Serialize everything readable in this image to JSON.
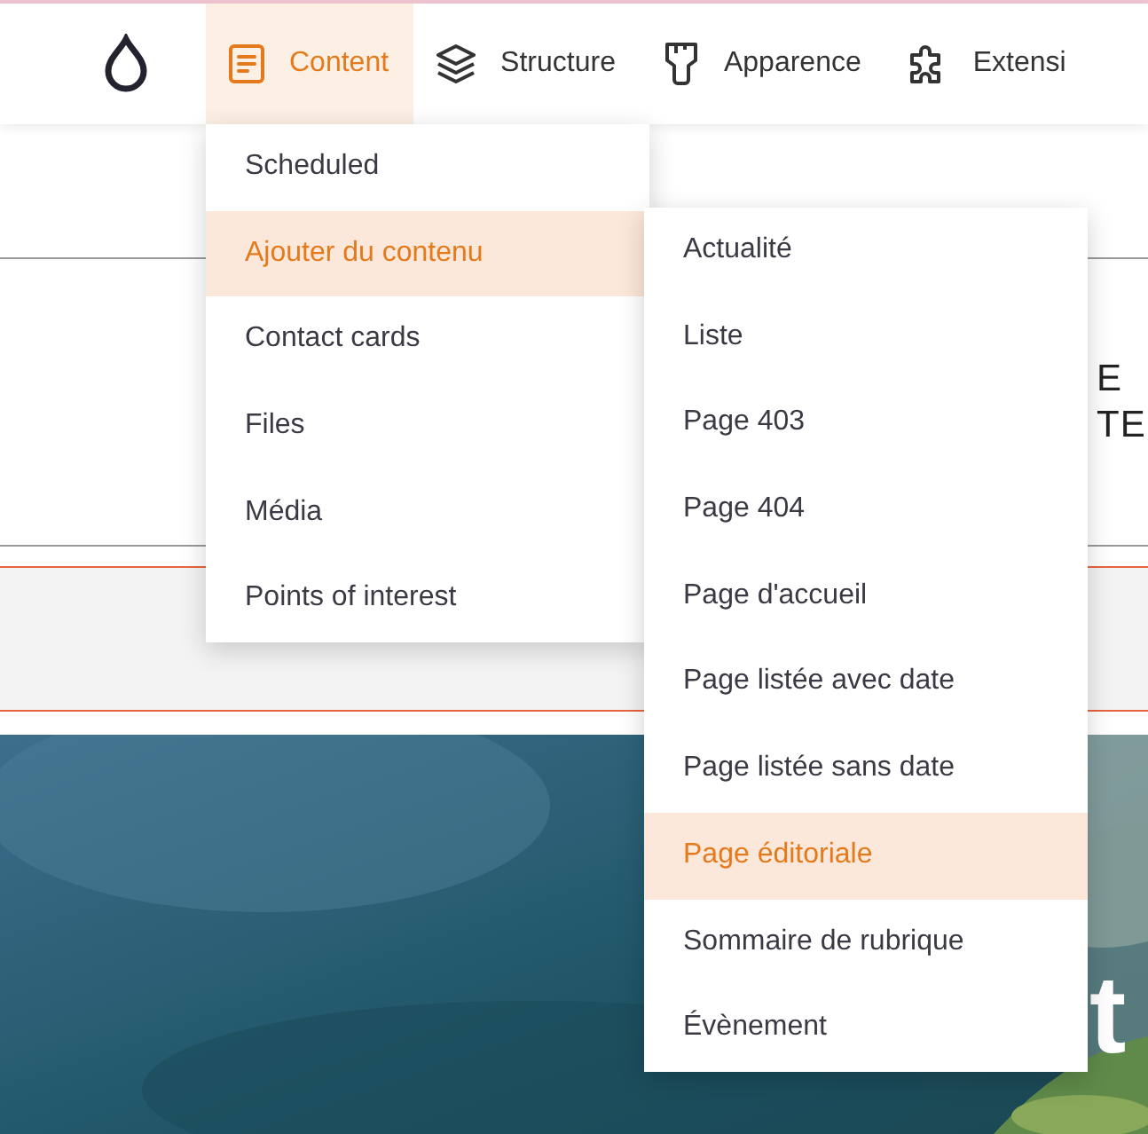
{
  "toolbar": {
    "tabs": [
      {
        "label": "Content",
        "selected": true
      },
      {
        "label": "Structure",
        "selected": false
      },
      {
        "label": "Apparence",
        "selected": false
      },
      {
        "label": "Extensi",
        "selected": false
      }
    ]
  },
  "menu": {
    "items": [
      {
        "label": "Scheduled",
        "selected": false
      },
      {
        "label": "Ajouter du contenu",
        "selected": true
      },
      {
        "label": "Contact cards",
        "selected": false
      },
      {
        "label": "Files",
        "selected": false
      },
      {
        "label": "Média",
        "selected": false
      },
      {
        "label": "Points of interest",
        "selected": false
      }
    ]
  },
  "submenu": {
    "items": [
      {
        "label": "Actualité",
        "selected": false
      },
      {
        "label": "Liste",
        "selected": false
      },
      {
        "label": "Page 403",
        "selected": false
      },
      {
        "label": "Page 404",
        "selected": false
      },
      {
        "label": "Page d'accueil",
        "selected": false
      },
      {
        "label": "Page listée avec date",
        "selected": false
      },
      {
        "label": "Page listée sans date",
        "selected": false
      },
      {
        "label": "Page éditoriale",
        "selected": true
      },
      {
        "label": "Sommaire de rubrique",
        "selected": false
      },
      {
        "label": "Évènement",
        "selected": false
      }
    ]
  },
  "page": {
    "heading_lines": [
      "E",
      "TE"
    ],
    "hero_text": "t"
  }
}
